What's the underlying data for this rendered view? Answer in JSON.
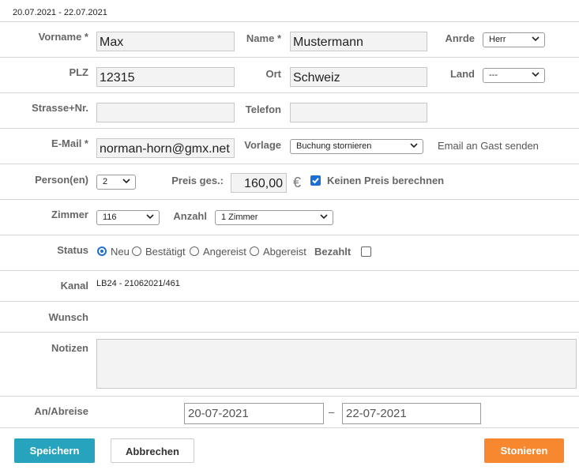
{
  "header": {
    "date_range": "20.07.2021 - 22.07.2021"
  },
  "labels": {
    "vorname": "Vorname *",
    "name": "Name *",
    "anrede": "Anrde",
    "plz": "PLZ",
    "ort": "Ort",
    "land": "Land",
    "strasse": "Strasse+Nr.",
    "telefon": "Telefon",
    "email": "E-Mail *",
    "vorlage": "Vorlage",
    "personen": "Person(en)",
    "preis": "Preis ges.:",
    "zimmer": "Zimmer",
    "anzahl": "Anzahl",
    "status": "Status",
    "kanal": "Kanal",
    "wunsch": "Wunsch",
    "notizen": "Notizen",
    "an_abreise": "An/Abreise"
  },
  "fields": {
    "vorname": "Max",
    "name": "Mustermann",
    "anrede": "Herr",
    "plz": "12315",
    "ort": "Schweiz",
    "land": "---",
    "strasse": "",
    "telefon": "",
    "email": "norman-horn@gmx.net",
    "vorlage": "Buchung stornieren",
    "email_send_text": "Email an Gast senden",
    "personen": "2",
    "preis": "160,00",
    "currency": "€",
    "kein_preis": "Keinen Preis berechnen",
    "zimmer": "116",
    "anzahl": "1 Zimmer",
    "kanal": "LB24 - 21062021/461",
    "notizen": "",
    "arrival": "20-07-2021",
    "date_sep": "–",
    "departure": "22-07-2021"
  },
  "status": {
    "options": [
      "Neu",
      "Bestätigt",
      "Angereist",
      "Abgereist"
    ],
    "selected": "Neu",
    "bezahlt_label": "Bezahlt",
    "bezahlt_checked": false
  },
  "buttons": {
    "save": "Speichern",
    "cancel": "Abbrechen",
    "storno": "Stonieren"
  },
  "colors": {
    "save": "#27a3be",
    "storno": "#f7882f",
    "accent": "#1d6fd6"
  }
}
